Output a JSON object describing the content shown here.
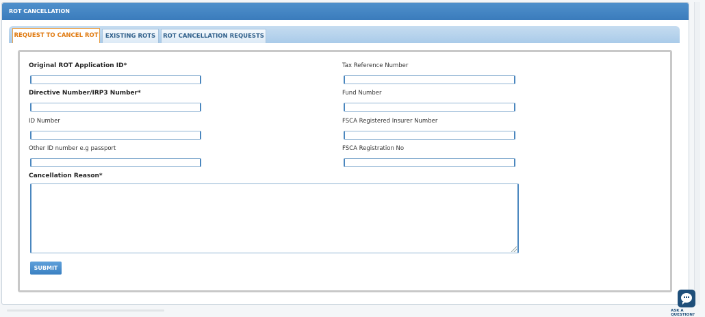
{
  "header": {
    "title": "ROT CANCELLATION"
  },
  "tabs": [
    {
      "label": "REQUEST TO CANCEL ROT",
      "active": true
    },
    {
      "label": "EXISTING ROTS",
      "active": false
    },
    {
      "label": "ROT CANCELLATION REQUESTS",
      "active": false
    }
  ],
  "form": {
    "original_rot_label": "Original ROT Application ID*",
    "original_rot_value": "",
    "tax_reference_label": "Tax Reference  Number",
    "tax_reference_value": "",
    "directive_label": "Directive Number/IRP3 Number*",
    "directive_value": "",
    "fund_number_label": "Fund Number",
    "fund_number_value": "",
    "id_number_label": "ID Number",
    "id_number_value": "",
    "fsca_insurer_label": "FSCA Registered Insurer Number",
    "fsca_insurer_value": "",
    "other_id_label": "Other ID number e.g passport",
    "other_id_value": "",
    "fsca_registration_label": "FSCA Registration No",
    "fsca_registration_value": "",
    "cancellation_reason_label": "Cancellation Reason*",
    "cancellation_reason_value": "",
    "submit_label": "SUBMIT"
  },
  "help_widget": {
    "label": "ASK A QUESTION?",
    "icon": "chat-bubble-icon"
  },
  "colors": {
    "header_blue": "#3b7cbc",
    "active_tab_text": "#e07a10",
    "submit_blue": "#3a80c2"
  }
}
